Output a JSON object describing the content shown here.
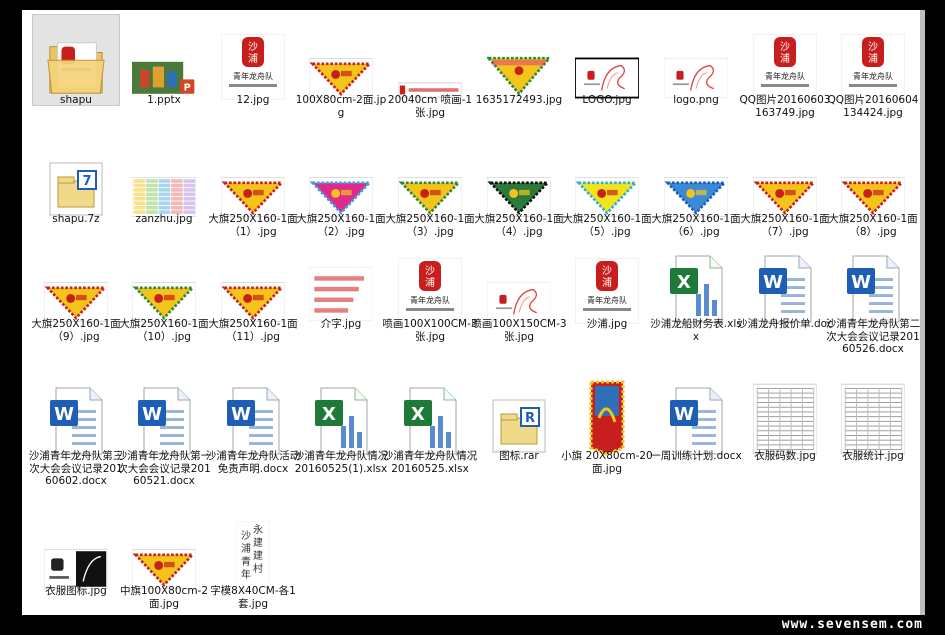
{
  "files": [
    {
      "name": "shapu",
      "type": "folder",
      "selected": true
    },
    {
      "name": "1.pptx",
      "type": "pptx"
    },
    {
      "name": "12.jpg",
      "type": "logo-red"
    },
    {
      "name": "100X80cm-2面.jpg",
      "type": "flag-yellow"
    },
    {
      "name": "20040cm 喷画-1张.jpg",
      "type": "banner-strip"
    },
    {
      "name": "1635172493.jpg",
      "type": "flag-multi"
    },
    {
      "name": "LOGO.jpg",
      "type": "logo-dragon-framed"
    },
    {
      "name": "logo.png",
      "type": "logo-dragon"
    },
    {
      "name": "QQ图片20160603163749.jpg",
      "type": "logo-red"
    },
    {
      "name": "QQ图片20160604134424.jpg",
      "type": "logo-red"
    },
    {
      "name": "shapu.7z",
      "type": "archive-7z"
    },
    {
      "name": "zanzhu.jpg",
      "type": "table-image"
    },
    {
      "name": "大旗250X160-1面（1）.jpg",
      "type": "flag-yellow"
    },
    {
      "name": "大旗250X160-1面（2）.jpg",
      "type": "flag-pink"
    },
    {
      "name": "大旗250X160-1面（3）.jpg",
      "type": "flag-green"
    },
    {
      "name": "大旗250X160-1面（4）.jpg",
      "type": "flag-dark"
    },
    {
      "name": "大旗250X160-1面（5）.jpg",
      "type": "flag-cyan"
    },
    {
      "name": "大旗250X160-1面（6）.jpg",
      "type": "flag-blue"
    },
    {
      "name": "大旗250X160-1面（7）.jpg",
      "type": "flag-yellow"
    },
    {
      "name": "大旗250X160-1面（8）.jpg",
      "type": "flag-yellow"
    },
    {
      "name": "大旗250X160-1面（9）.jpg",
      "type": "flag-yellow"
    },
    {
      "name": "大旗250X160-1面（10）.jpg",
      "type": "flag-green"
    },
    {
      "name": "大旗250X160-1面（11）.jpg",
      "type": "flag-yellow"
    },
    {
      "name": "介字.jpg",
      "type": "text-red"
    },
    {
      "name": "喷画100X100CM-3张.jpg",
      "type": "logo-red"
    },
    {
      "name": "喷画100X150CM-3张.jpg",
      "type": "logo-dragon"
    },
    {
      "name": "沙浦.jpg",
      "type": "logo-red"
    },
    {
      "name": "沙浦龙船财务表.xlsx",
      "type": "xlsx"
    },
    {
      "name": "沙浦龙舟报价单.doc",
      "type": "docx"
    },
    {
      "name": "沙浦青年龙舟队第二次大会会议记录20160526.docx",
      "type": "docx"
    },
    {
      "name": "沙浦青年龙舟队第三次大会会议记录20160602.docx",
      "type": "docx"
    },
    {
      "name": "沙浦青年龙舟队第一次大会会议记录20160521.docx",
      "type": "docx"
    },
    {
      "name": "沙浦青年龙舟队活动免责声明.docx",
      "type": "docx"
    },
    {
      "name": "沙浦青年龙舟队情况20160525(1).xlsx",
      "type": "xlsx"
    },
    {
      "name": "沙浦青年龙舟队情况20160525.xlsx",
      "type": "xlsx"
    },
    {
      "name": "图标.rar",
      "type": "archive-rar"
    },
    {
      "name": "小旗 20X80cm-20面.jpg",
      "type": "pennant"
    },
    {
      "name": "一周训练计划.docx",
      "type": "docx"
    },
    {
      "name": "衣服码数.jpg",
      "type": "sheet-image"
    },
    {
      "name": "衣服统计.jpg",
      "type": "sheet-image"
    },
    {
      "name": "衣服图标.jpg",
      "type": "logo-black"
    },
    {
      "name": "中旗100X80cm-2面.jpg",
      "type": "flag-yellow"
    },
    {
      "name": "字模8X40CM-各1套.jpg",
      "type": "text-vertical"
    }
  ],
  "vertical_text": {
    "col1": "沙浦青年",
    "col2": "永建建村"
  },
  "logo_text": {
    "chars": "沙浦",
    "team": "青年龙舟队",
    "sub": "Dragon boat team of Shapu"
  },
  "watermark": "www.sevensem.com"
}
